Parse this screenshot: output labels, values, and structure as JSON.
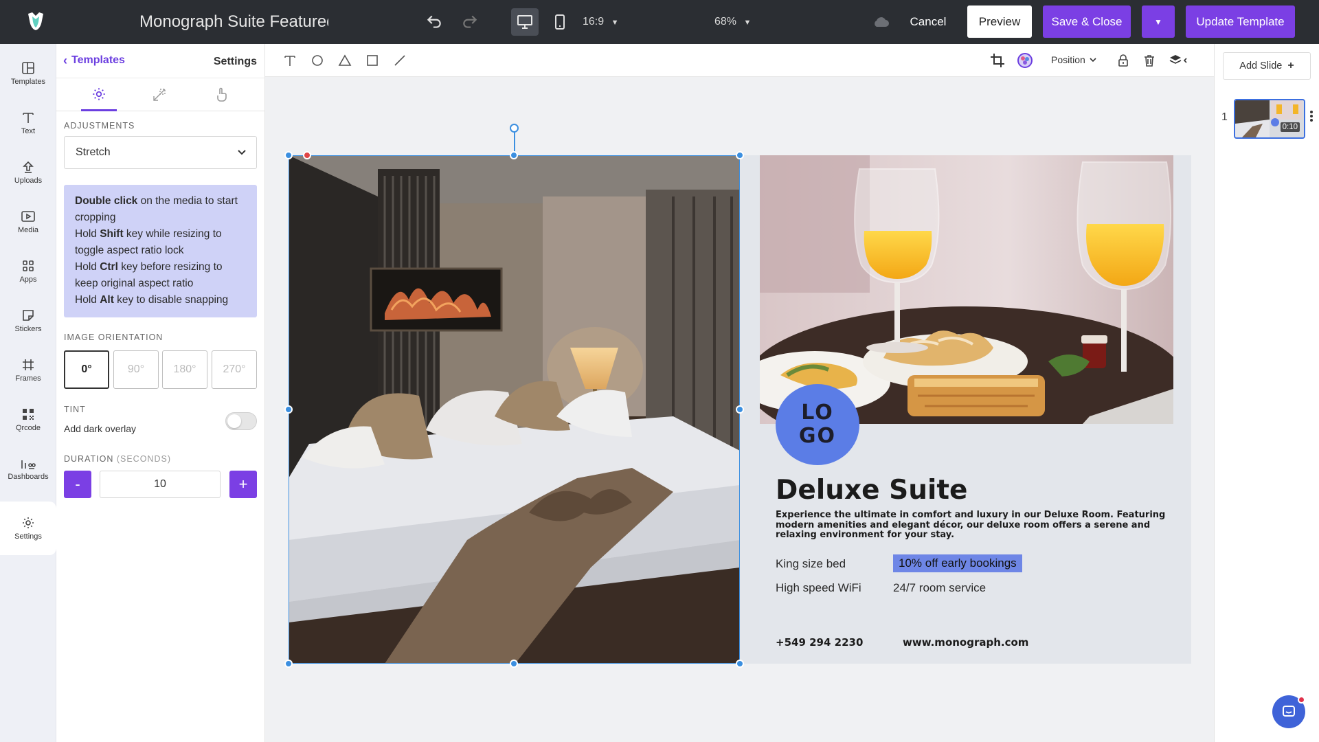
{
  "topbar": {
    "title": "Monograph Suite Featured",
    "aspect_ratio": "16:9",
    "zoom": "68%",
    "cancel_label": "Cancel",
    "preview_label": "Preview",
    "save_close_label": "Save & Close",
    "update_label": "Update Template"
  },
  "rail": {
    "items": [
      {
        "label": "Templates",
        "icon": "templates-icon"
      },
      {
        "label": "Text",
        "icon": "text-icon"
      },
      {
        "label": "Uploads",
        "icon": "upload-icon"
      },
      {
        "label": "Media",
        "icon": "media-icon"
      },
      {
        "label": "Apps",
        "icon": "apps-icon"
      },
      {
        "label": "Stickers",
        "icon": "sticker-icon"
      },
      {
        "label": "Frames",
        "icon": "frame-icon"
      },
      {
        "label": "Qrcode",
        "icon": "qrcode-icon"
      },
      {
        "label": "Dashboards",
        "icon": "dashboard-icon"
      },
      {
        "label": "Settings",
        "icon": "settings-icon"
      }
    ],
    "active": "Settings"
  },
  "panel": {
    "back_label": "Templates",
    "title": "Settings",
    "adjustments_label": "Adjustments",
    "adjustment_value": "Stretch",
    "help": {
      "l1_bold": "Double click",
      "l1_rest": " on the media to start cropping",
      "l2_pre": "Hold ",
      "l2_bold": "Shift",
      "l2_rest": " key while resizing to toggle aspect ratio lock",
      "l3_pre": "Hold ",
      "l3_bold": "Ctrl",
      "l3_rest": " key before resizing to keep original aspect ratio",
      "l4_pre": "Hold ",
      "l4_bold": "Alt",
      "l4_rest": " key to disable snapping"
    },
    "orientation_label": "Image Orientation",
    "orientations": [
      "0°",
      "90°",
      "180°",
      "270°"
    ],
    "selected_orientation": "0°",
    "tint_label": "Tint",
    "tint_sub": "Add dark overlay",
    "tint_on": false,
    "duration_label": "Duration",
    "duration_unit": "(Seconds)",
    "duration_value": "10",
    "minus_label": "-",
    "plus_label": "+"
  },
  "editbar": {
    "position_label": "Position"
  },
  "slide": {
    "logo_line1": "LO",
    "logo_line2": "GO",
    "title": "Deluxe Suite",
    "description": "Experience the ultimate in comfort and luxury in our Deluxe Room. Featuring modern amenities and elegant décor, our deluxe room offers a serene and relaxing environment for your stay.",
    "features": [
      "King size bed",
      "10% off early bookings",
      "High speed WiFi",
      "24/7 room service"
    ],
    "phone": "+549 294 2230",
    "website": "www.monograph.com"
  },
  "slides_rail": {
    "add_label": "Add Slide",
    "slide_number": "1",
    "slide_duration": "0:10"
  },
  "colors": {
    "accent": "#7b3fe4",
    "selection": "#3b8fe0",
    "logo": "#5b7de6",
    "help_bg": "#cfd2f7"
  }
}
